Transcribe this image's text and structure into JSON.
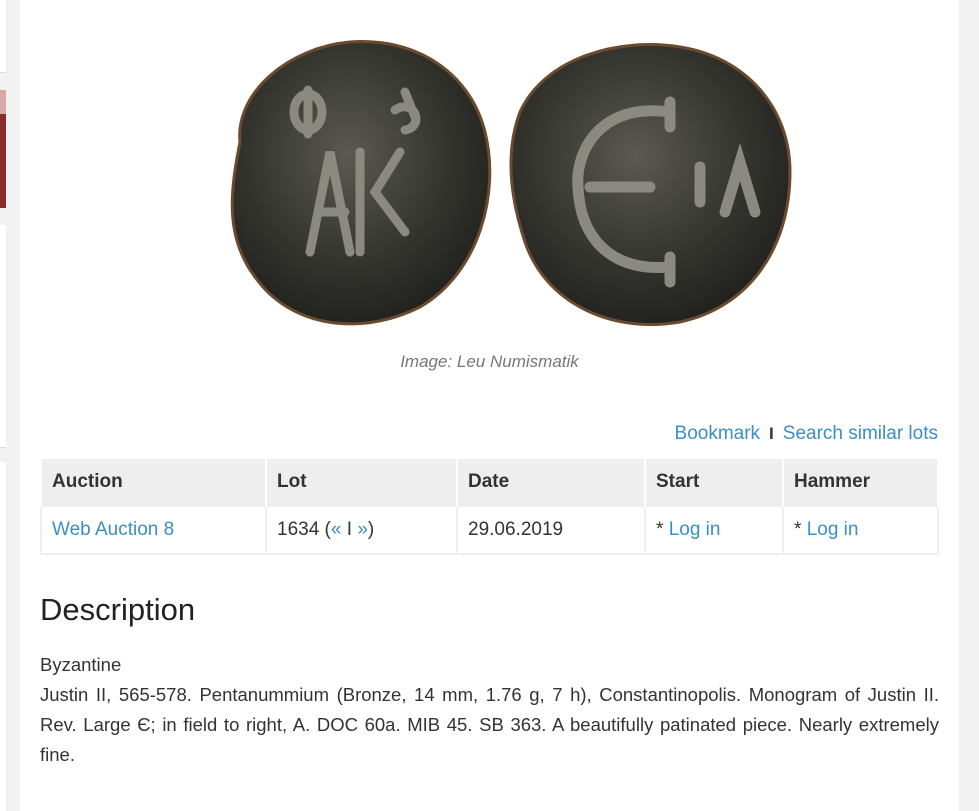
{
  "image_caption": "Image: Leu Numismatik",
  "actions": {
    "bookmark": "Bookmark",
    "separator": "I",
    "search_similar": "Search similar lots"
  },
  "table": {
    "headers": [
      "Auction",
      "Lot",
      "Date",
      "Start",
      "Hammer"
    ],
    "row": {
      "auction": "Web Auction 8",
      "lot_number": "1634",
      "lot_prev": "«",
      "lot_sep": "I",
      "lot_next": "»",
      "date": "29.06.2019",
      "start_prefix": "*",
      "start_link": "Log in",
      "hammer_prefix": "*",
      "hammer_link": "Log in"
    }
  },
  "description": {
    "title": "Description",
    "category": "Byzantine",
    "text": "Justin II, 565-578. Pentanummium (Bronze, 14 mm, 1.76 g, 7 h), Constantinopolis. Monogram of Justin II. Rev. Large Є; in field to right, A. DOC 60a. MIB 45. SB 363. A beautifully patinated piece. Nearly extremely fine."
  },
  "colors": {
    "link": "#3b8fc4",
    "table_header_bg": "#eeeeee",
    "sidebar_accent": "#8b2a2a"
  }
}
